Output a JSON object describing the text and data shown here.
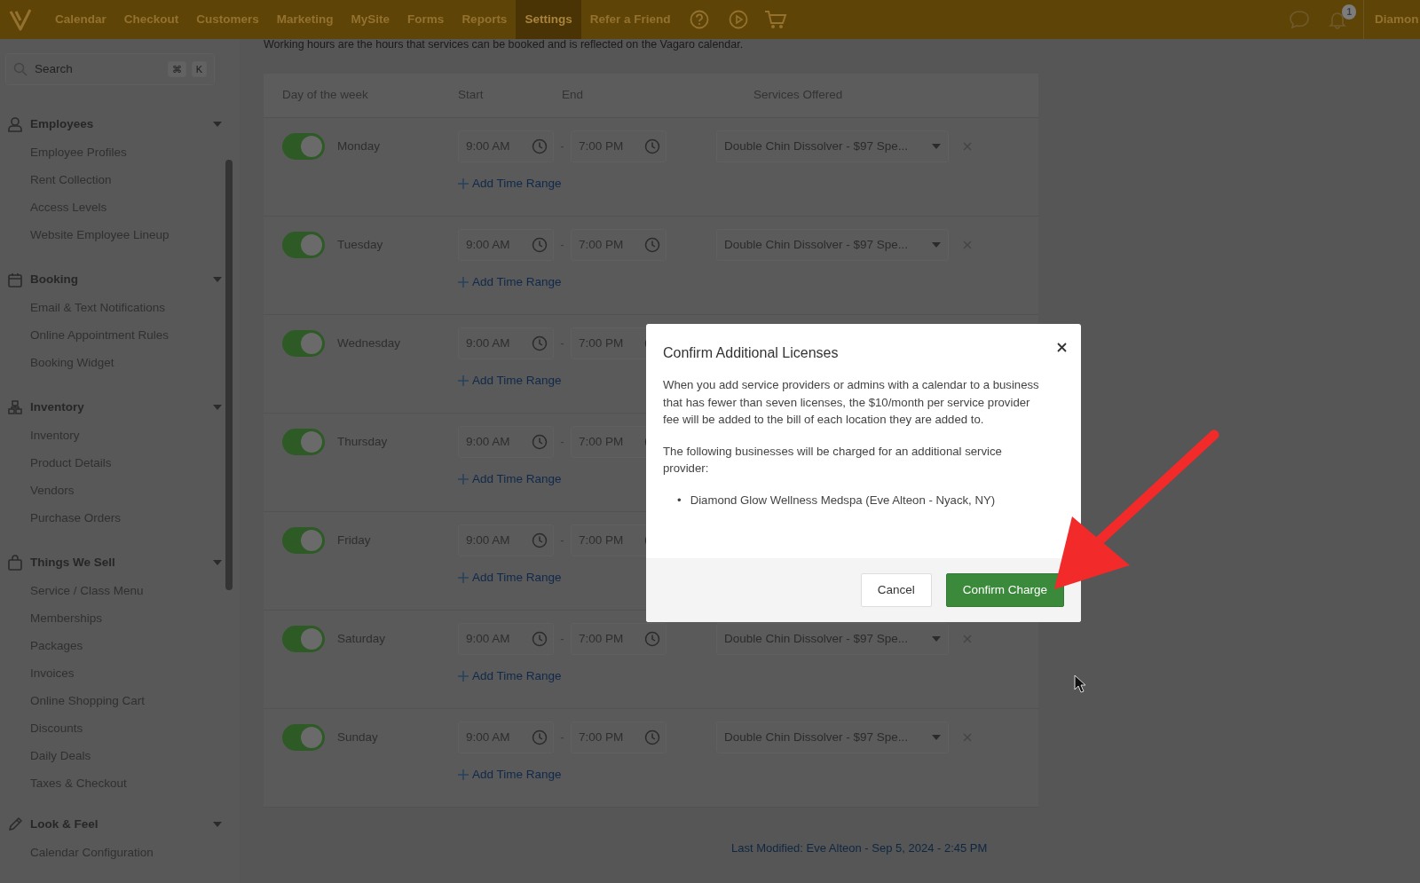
{
  "nav": {
    "items": [
      {
        "label": "Calendar",
        "selected": false
      },
      {
        "label": "Checkout",
        "selected": false
      },
      {
        "label": "Customers",
        "selected": false
      },
      {
        "label": "Marketing",
        "selected": false
      },
      {
        "label": "MySite",
        "selected": false
      },
      {
        "label": "Forms",
        "selected": false
      },
      {
        "label": "Reports",
        "selected": false
      },
      {
        "label": "Settings",
        "selected": true
      },
      {
        "label": "Refer a Friend",
        "selected": false
      }
    ],
    "notification_count": "1",
    "user": "Diamon"
  },
  "search": {
    "placeholder": "Search",
    "keys": [
      "⌘",
      "K"
    ]
  },
  "sidebar": {
    "sections": [
      {
        "title": "Employees",
        "expanded": true,
        "items": [
          "Employee Profiles",
          "Rent Collection",
          "Access Levels",
          "Website Employee Lineup"
        ]
      },
      {
        "title": "Booking",
        "expanded": true,
        "items": [
          "Email & Text Notifications",
          "Online Appointment Rules",
          "Booking Widget"
        ]
      },
      {
        "title": "Inventory",
        "expanded": true,
        "items": [
          "Inventory",
          "Product Details",
          "Vendors",
          "Purchase Orders"
        ]
      },
      {
        "title": "Things We Sell",
        "expanded": true,
        "items": [
          "Service / Class Menu",
          "Memberships",
          "Packages",
          "Invoices",
          "Online Shopping Cart",
          "Discounts",
          "Daily Deals",
          "Taxes & Checkout"
        ]
      },
      {
        "title": "Look & Feel",
        "expanded": true,
        "items": [
          "Calendar Configuration"
        ]
      }
    ]
  },
  "description": "Working hours are the hours that services can be booked and is reflected on the Vagaro calendar.",
  "table": {
    "columns": [
      "Day of the week",
      "Start",
      "End",
      "Services Offered"
    ],
    "rows": [
      {
        "day": "Monday",
        "on": true,
        "start": "9:00 AM",
        "separator": "-",
        "end": "7:00 PM",
        "service": "Double Chin Dissolver - $97 Spe...",
        "add_link": "Add Time Range"
      },
      {
        "day": "Tuesday",
        "on": true,
        "start": "9:00 AM",
        "separator": "-",
        "end": "7:00 PM",
        "service": "Double Chin Dissolver - $97 Spe...",
        "add_link": "Add Time Range"
      },
      {
        "day": "Wednesday",
        "on": true,
        "start": "9:00 AM",
        "separator": "-",
        "end": "7:00 PM",
        "add_link": "Add Time Range"
      },
      {
        "day": "Thursday",
        "on": true,
        "start": "9:00 AM",
        "separator": "-",
        "end": "7:00 PM",
        "add_link": "Add Time Range"
      },
      {
        "day": "Friday",
        "on": true,
        "start": "9:00 AM",
        "separator": "-",
        "end": "7:00 PM",
        "add_link": "Add Time Range"
      },
      {
        "day": "Saturday",
        "on": true,
        "start": "9:00 AM",
        "separator": "-",
        "end": "7:00 PM",
        "service": "Double Chin Dissolver - $97 Spe...",
        "add_link": "Add Time Range"
      },
      {
        "day": "Sunday",
        "on": true,
        "start": "9:00 AM",
        "separator": "-",
        "end": "7:00 PM",
        "service": "Double Chin Dissolver - $97 Spe...",
        "add_link": "Add Time Range"
      }
    ]
  },
  "last_modified": "Last Modified: Eve Alteon - Sep 5, 2024 - 2:45 PM",
  "modal": {
    "title": "Confirm Additional Licenses",
    "paragraphs": [
      "When you add service providers or admins with a calendar to a business that has fewer than seven licenses, the $10/month per service provider fee will be added to the bill of each location they are added to.",
      "The following businesses will be charged for an additional service provider:"
    ],
    "list": [
      {
        "marker": "•",
        "text": "Diamond Glow Wellness Medspa (Eve Alteon - Nyack, NY)"
      }
    ],
    "buttons": [
      {
        "label": "Cancel",
        "kind": "secondary"
      },
      {
        "label": "Confirm Charge",
        "kind": "primary"
      }
    ]
  }
}
